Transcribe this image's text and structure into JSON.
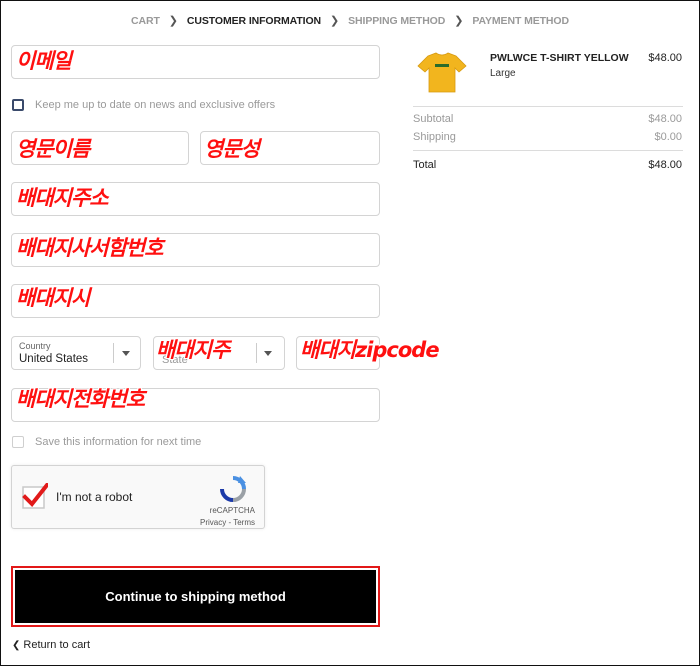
{
  "breadcrumb": {
    "items": [
      "CART",
      "CUSTOMER INFORMATION",
      "SHIPPING METHOD",
      "PAYMENT METHOD"
    ]
  },
  "form": {
    "email_label": "이메일",
    "newsletter_label": "Keep me up to date on news and exclusive offers",
    "first_name_label": "영문이름",
    "last_name_label": "영문성",
    "address_label": "배대지주소",
    "address2_label": "배대지사서함번호",
    "city_label": "배대지시",
    "country_label": "Country",
    "country_value": "United States",
    "state_label": "배대지주",
    "state_placeholder": "State",
    "zip_label": "배대지zipcode",
    "phone_label": "배대지전화번호",
    "save_info_label": "Save this information for next time"
  },
  "recaptcha": {
    "label": "I'm not a robot",
    "brand": "reCAPTCHA",
    "links": "Privacy - Terms"
  },
  "actions": {
    "continue_label": "Continue to shipping method",
    "return_label": "Return to cart"
  },
  "summary": {
    "product_name": "PWLWCE T-SHIRT YELLOW",
    "product_variant": "Large",
    "product_price": "$48.00",
    "subtotal_label": "Subtotal",
    "subtotal_value": "$48.00",
    "shipping_label": "Shipping",
    "shipping_value": "$0.00",
    "total_label": "Total",
    "total_value": "$48.00"
  },
  "colors": {
    "annotation": "#ff1010",
    "button_bg": "#000000",
    "button_outline": "#e21818",
    "shirt": "#f2b51e"
  },
  "icons": {
    "chevron": "chevron-right-icon",
    "back": "chevron-left-icon",
    "caret": "caret-down-icon",
    "recaptcha": "recaptcha-logo-icon",
    "check": "checkmark-icon"
  }
}
